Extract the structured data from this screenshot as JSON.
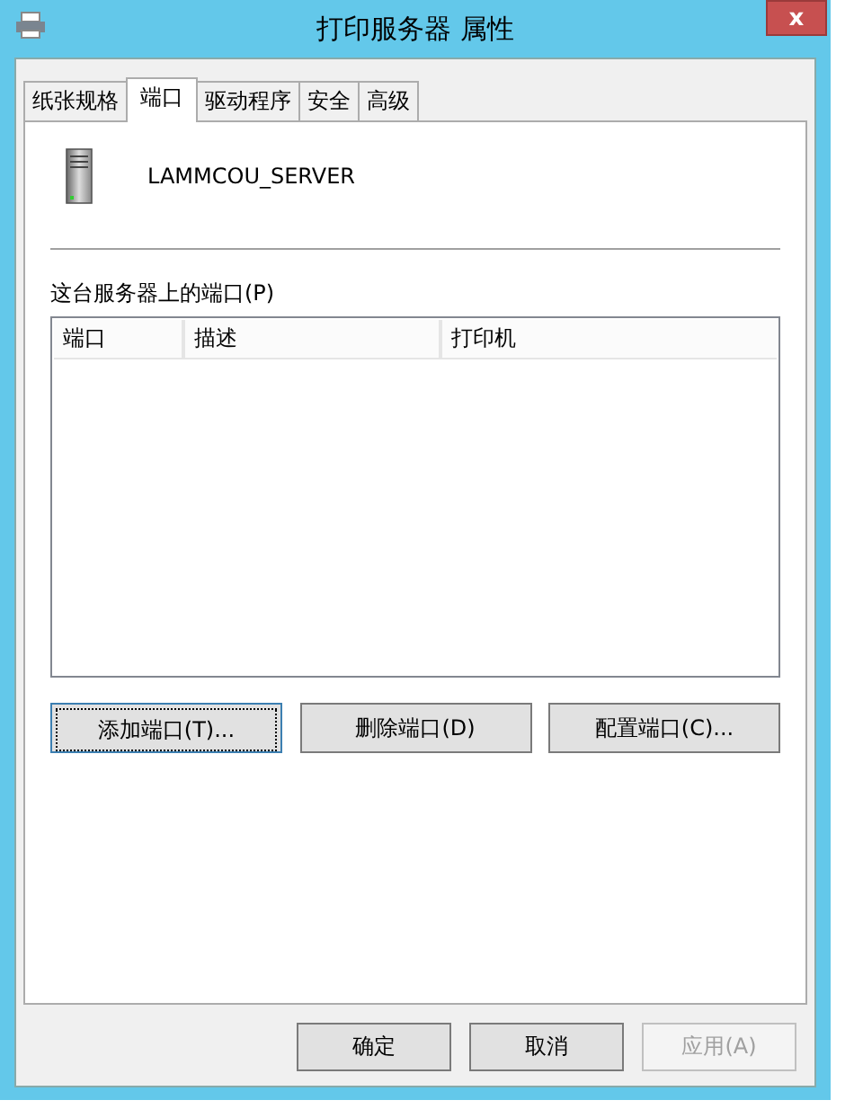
{
  "window": {
    "title": "打印服务器 属性",
    "close": "x"
  },
  "tabs": [
    {
      "label": "纸张规格",
      "selected": false
    },
    {
      "label": "端口",
      "selected": true
    },
    {
      "label": "驱动程序",
      "selected": false
    },
    {
      "label": "安全",
      "selected": false
    },
    {
      "label": "高级",
      "selected": false
    }
  ],
  "server": {
    "name": "LAMMCOU_SERVER"
  },
  "ports_label": "这台服务器上的端口(P)",
  "table": {
    "columns": [
      "端口",
      "描述",
      "打印机"
    ]
  },
  "port_buttons": [
    {
      "label": "添加端口(T)...",
      "focused": true
    },
    {
      "label": "删除端口(D)",
      "focused": false
    },
    {
      "label": "配置端口(C)...",
      "focused": false
    }
  ],
  "buttons": [
    {
      "label": "确定",
      "disabled": false
    },
    {
      "label": "取消",
      "disabled": false
    },
    {
      "label": "应用(A)",
      "disabled": true
    }
  ]
}
